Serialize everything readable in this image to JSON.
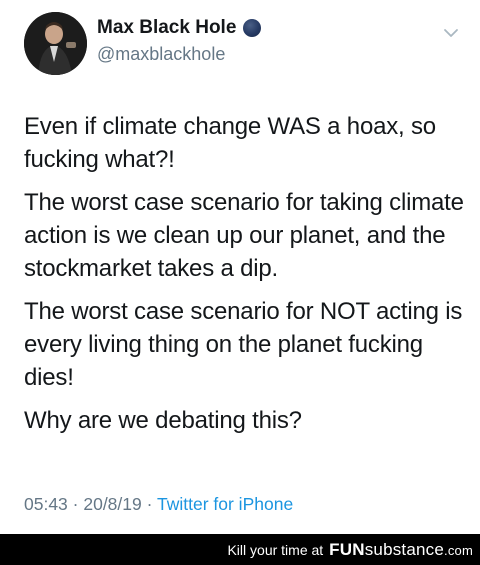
{
  "tweet": {
    "display_name": "Max Black Hole",
    "handle": "@maxblackhole",
    "paragraphs": [
      "Even if climate change WAS a hoax, so fucking what?!",
      "The worst case scenario for taking climate action is we clean up our planet, and the stockmarket takes a dip.",
      "The worst case scenario for NOT acting is every living thing on the planet fucking dies!",
      "Why are we debating this?"
    ],
    "time": "05:43",
    "separator1": " · ",
    "date": "20/8/19",
    "separator2": " · ",
    "source": "Twitter for iPhone"
  },
  "footer": {
    "tagline": "Kill your time at",
    "brand_bold": "FUN",
    "brand_rest": "substance",
    "brand_suffix": ".com"
  },
  "colors": {
    "text": "#14171a",
    "secondary": "#657786",
    "link": "#1b95e0",
    "footer_bg": "#000000"
  },
  "icons": {
    "badge": "planet-emoji-icon",
    "caret": "chevron-down-icon"
  }
}
